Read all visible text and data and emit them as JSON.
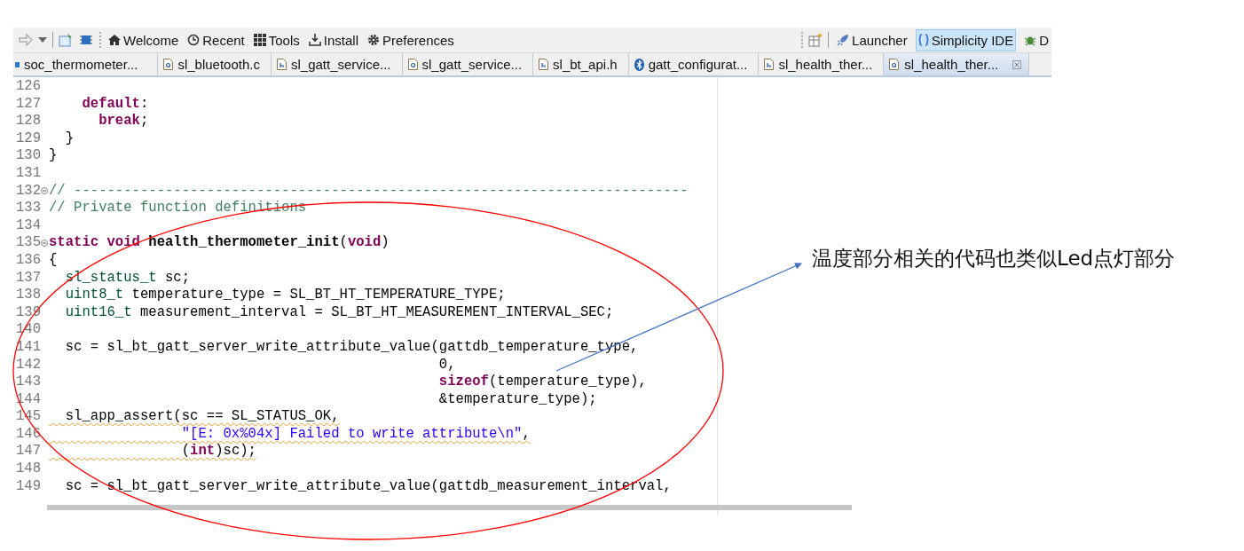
{
  "toolbar": {
    "buttons": [
      {
        "label": "Welcome"
      },
      {
        "label": "Recent"
      },
      {
        "label": "Tools"
      },
      {
        "label": "Install"
      },
      {
        "label": "Preferences"
      }
    ],
    "perspectives": [
      {
        "label": "Launcher",
        "selected": false
      },
      {
        "label": "Simplicity IDE",
        "selected": true
      },
      {
        "label": "D",
        "selected": false
      }
    ]
  },
  "tabs": [
    {
      "label": "soc_thermometer...",
      "kind": "project",
      "selected": false
    },
    {
      "label": "sl_bluetooth.c",
      "kind": "source",
      "selected": false
    },
    {
      "label": "sl_gatt_service...",
      "kind": "header",
      "selected": false
    },
    {
      "label": "sl_gatt_service...",
      "kind": "source",
      "selected": false
    },
    {
      "label": "sl_bt_api.h",
      "kind": "header",
      "selected": false
    },
    {
      "label": "gatt_configurat...",
      "kind": "bluetooth",
      "selected": false
    },
    {
      "label": "sl_health_ther...",
      "kind": "header",
      "selected": false
    },
    {
      "label": "sl_health_ther...",
      "kind": "source",
      "selected": true
    }
  ],
  "code": [
    {
      "number": "126"
    },
    {
      "number": "127",
      "tokens": [
        {
          "kind": "keyword",
          "text": "    default"
        },
        {
          "kind": "plain",
          "text": ":"
        }
      ]
    },
    {
      "number": "128",
      "tokens": [
        {
          "kind": "keyword",
          "text": "      break"
        },
        {
          "kind": "plain",
          "text": ";"
        }
      ]
    },
    {
      "number": "129",
      "tokens": [
        {
          "kind": "plain",
          "text": "  }"
        }
      ]
    },
    {
      "number": "130",
      "tokens": [
        {
          "kind": "plain",
          "text": "}"
        }
      ]
    },
    {
      "number": "131"
    },
    {
      "number": "132",
      "folded": true,
      "tokens": [
        {
          "kind": "comment",
          "text": "// --------------------------------------------------------------------------"
        }
      ]
    },
    {
      "number": "133",
      "tokens": [
        {
          "kind": "comment",
          "text": "// Private function definitions"
        }
      ]
    },
    {
      "number": "134"
    },
    {
      "number": "135",
      "folded": true,
      "tokens": [
        {
          "kind": "keyword",
          "text": "static void"
        },
        {
          "kind": "function",
          "text": " health_thermometer_init"
        },
        {
          "kind": "plain",
          "text": "("
        },
        {
          "kind": "keyword",
          "text": "void"
        },
        {
          "kind": "plain",
          "text": ")"
        }
      ]
    },
    {
      "number": "136",
      "tokens": [
        {
          "kind": "plain",
          "text": "{"
        }
      ]
    },
    {
      "number": "137",
      "tokens": [
        {
          "kind": "type",
          "text": "  sl_status_t"
        },
        {
          "kind": "plain",
          "text": " sc;"
        }
      ]
    },
    {
      "number": "138",
      "tokens": [
        {
          "kind": "type",
          "text": "  uint8_t"
        },
        {
          "kind": "plain",
          "text": " temperature_type = SL_BT_HT_TEMPERATURE_TYPE;"
        }
      ]
    },
    {
      "number": "139",
      "tokens": [
        {
          "kind": "type",
          "text": "  uint16_t"
        },
        {
          "kind": "plain",
          "text": " measurement_interval = SL_BT_HT_MEASUREMENT_INTERVAL_SEC;"
        }
      ]
    },
    {
      "number": "140"
    },
    {
      "number": "141",
      "tokens": [
        {
          "kind": "plain",
          "text": "  sc = sl_bt_gatt_server_write_attribute_value(gattdb_temperature_type,"
        }
      ]
    },
    {
      "number": "142",
      "tokens": [
        {
          "kind": "plain",
          "text": "                                               0,"
        }
      ]
    },
    {
      "number": "143",
      "tokens": [
        {
          "kind": "keyword",
          "text": "                                               sizeof"
        },
        {
          "kind": "plain",
          "text": "(temperature_type),"
        }
      ]
    },
    {
      "number": "144",
      "tokens": [
        {
          "kind": "plain",
          "text": "                                               &temperature_type);"
        }
      ]
    },
    {
      "number": "145",
      "warning": true,
      "tokens": [
        {
          "kind": "plain",
          "text": "  sl_app_assert(sc == SL_STATUS_OK,"
        }
      ]
    },
    {
      "number": "146",
      "warning": true,
      "tokens": [
        {
          "kind": "string",
          "text": "                \"[E: 0x%04x] Failed to write attribute\\n\""
        },
        {
          "kind": "plain",
          "text": ","
        }
      ]
    },
    {
      "number": "147",
      "warning": true,
      "tokens": [
        {
          "kind": "plain",
          "text": "                ("
        },
        {
          "kind": "keyword",
          "text": "int"
        },
        {
          "kind": "plain",
          "text": ")sc);"
        }
      ]
    },
    {
      "number": "148"
    },
    {
      "number": "149",
      "tokens": [
        {
          "kind": "plain",
          "text": "  sc = sl_bt_gatt_server_write_attribute_value(gattdb_measurement_interval,"
        }
      ]
    }
  ],
  "annotation": {
    "text": "温度部分相关的代码也类似Led点灯部分"
  }
}
